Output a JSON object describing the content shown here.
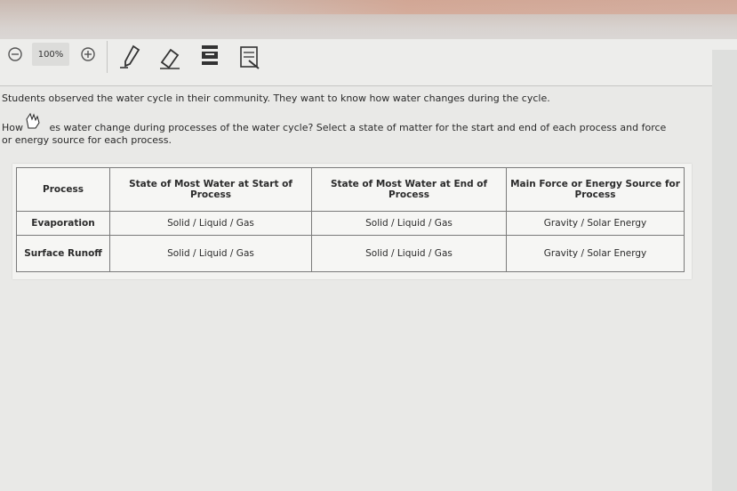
{
  "toolbar": {
    "zoom_level": "100%",
    "icons": [
      "zoom-out-icon",
      "zoom-in-icon",
      "pen-icon",
      "eraser-icon",
      "highlighter-icon",
      "notes-icon"
    ]
  },
  "question": {
    "intro": "Students observed the water cycle in their community. They want to know how water changes during the cycle.",
    "prompt_part1": "How ",
    "prompt_part2": "es water change during processes of the water cycle? Select a state of matter for the start and end of each process and force or energy source for each process."
  },
  "table": {
    "headers": [
      "Process",
      "State of Most Water at Start of Process",
      "State of Most Water at End of Process",
      "Main Force or Energy Source for Process"
    ],
    "rows": [
      {
        "process": "Evaporation",
        "start": "Solid / Liquid / Gas",
        "end": "Solid / Liquid / Gas",
        "force": "Gravity / Solar Energy"
      },
      {
        "process": "Surface Runoff",
        "start": "Solid / Liquid / Gas",
        "end": "Solid / Liquid / Gas",
        "force": "Gravity / Solar Energy"
      }
    ]
  },
  "colors": {
    "page_bg": "#e9e9e7",
    "toolbar_bg": "#ededeb",
    "table_border": "#7a7a7a"
  }
}
